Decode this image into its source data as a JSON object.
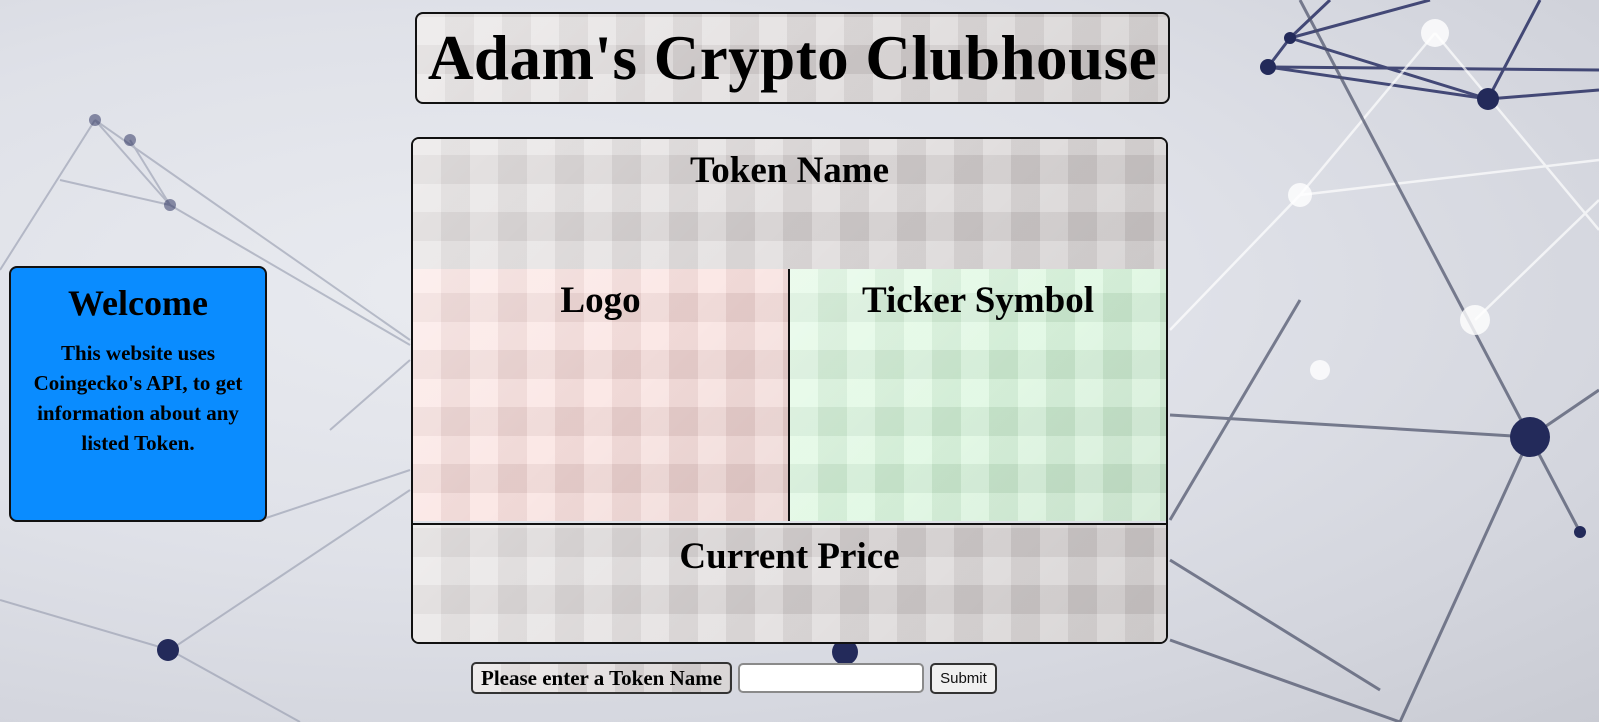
{
  "header": {
    "title": "Adam's Crypto Clubhouse"
  },
  "welcome": {
    "heading": "Welcome",
    "message": "This website uses Coingecko's API, to get information about any listed Token."
  },
  "card": {
    "token_name_heading": "Token Name",
    "logo_heading": "Logo",
    "ticker_heading": "Ticker Symbol",
    "price_heading": "Current Price"
  },
  "form": {
    "label": "Please enter a Token Name",
    "input_value": "",
    "submit_label": "Submit"
  },
  "colors": {
    "welcome_bg": "#0a8cff",
    "logo_cell_bg": "#f9dddb",
    "ticker_cell_bg": "#d6f6da",
    "panel_bg": "#dcd7d7"
  }
}
